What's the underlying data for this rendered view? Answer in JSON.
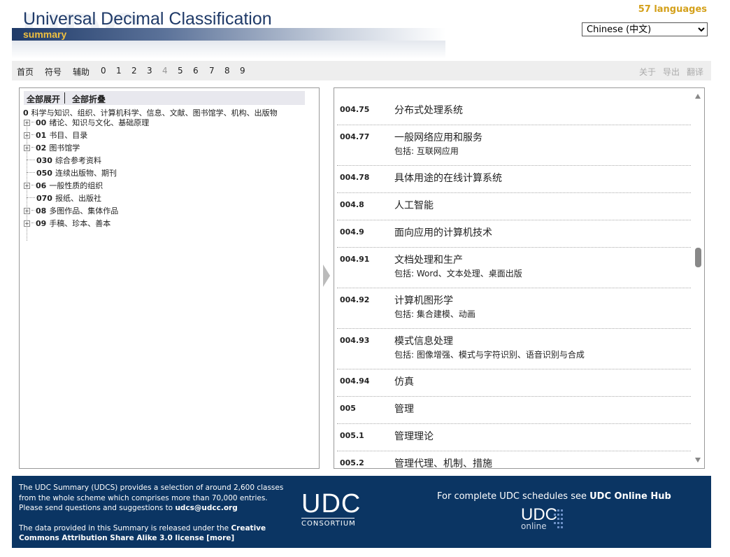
{
  "header": {
    "title": "Universal Decimal Classification",
    "subtitle": "summary",
    "watermark": "UDC",
    "languages_count": "57 languages",
    "language_selected": "Chinese (中文)"
  },
  "nav": {
    "left": [
      "首页",
      "符号",
      "辅助",
      "0",
      "1",
      "2",
      "3",
      "4",
      "5",
      "6",
      "7",
      "8",
      "9"
    ],
    "right": [
      "关于",
      "导出",
      "翻译"
    ]
  },
  "tree_toolbar": {
    "expand_all": "全部展开",
    "collapse_all": "全部折叠"
  },
  "tree": [
    {
      "code": "0",
      "label": "科学与知识、组织、计算机科学、信息、文献、图书馆学、机构、出版物",
      "expandable": false,
      "root": true
    },
    {
      "code": "00",
      "label": "绪论、知识与文化、基础原理",
      "expandable": true
    },
    {
      "code": "01",
      "label": "书目、目录",
      "expandable": true
    },
    {
      "code": "02",
      "label": "图书馆学",
      "expandable": true
    },
    {
      "code": "030",
      "label": "综合参考资料",
      "expandable": false
    },
    {
      "code": "050",
      "label": "连续出版物、期刊",
      "expandable": false
    },
    {
      "code": "06",
      "label": "一般性质的组织",
      "expandable": true
    },
    {
      "code": "070",
      "label": "报纸、出版社",
      "expandable": false
    },
    {
      "code": "08",
      "label": "多图作品、集体作品",
      "expandable": true
    },
    {
      "code": "09",
      "label": "手稿、珍本、善本",
      "expandable": true
    }
  ],
  "classes": [
    {
      "code": "004.75",
      "title": "分布式处理系统",
      "note": ""
    },
    {
      "code": "004.77",
      "title": "一般网络应用和服务",
      "note": "包括: 互联网应用"
    },
    {
      "code": "004.78",
      "title": "具体用途的在线计算系统",
      "note": ""
    },
    {
      "code": "004.8",
      "title": "人工智能",
      "note": ""
    },
    {
      "code": "004.9",
      "title": "面向应用的计算机技术",
      "note": ""
    },
    {
      "code": "004.91",
      "title": "文档处理和生产",
      "note": "包括: Word、文本处理、桌面出版"
    },
    {
      "code": "004.92",
      "title": "计算机图形学",
      "note": "包括: 集合建模、动画"
    },
    {
      "code": "004.93",
      "title": "模式信息处理",
      "note": "包括: 图像增强、模式与字符识别、语音识别与合成"
    },
    {
      "code": "004.94",
      "title": "仿真",
      "note": ""
    },
    {
      "code": "005",
      "title": "管理",
      "note": ""
    },
    {
      "code": "005.1",
      "title": "管理理论",
      "note": ""
    },
    {
      "code": "005.2",
      "title": "管理代理、机制、措施",
      "note": ""
    }
  ],
  "footer": {
    "p1_a": "The UDC Summary (UDCS) provides a selection of around 2,600 classes from the whole scheme which comprises more than 70,000 entries. Please send questions and suggestions to ",
    "p1_email": "udcs@udcc.org",
    "p2_a": "The data provided in this Summary is released under the ",
    "p2_license": "Creative Commons Attribution Share Alike 3.0 license",
    "p2_more": "[more]",
    "logo_big": "UDC",
    "logo_small": "CONSORTIUM",
    "hub_text": "For complete UDC schedules see ",
    "hub_link": "UDC Online Hub",
    "online_big": "UDC",
    "online_small": "online"
  }
}
